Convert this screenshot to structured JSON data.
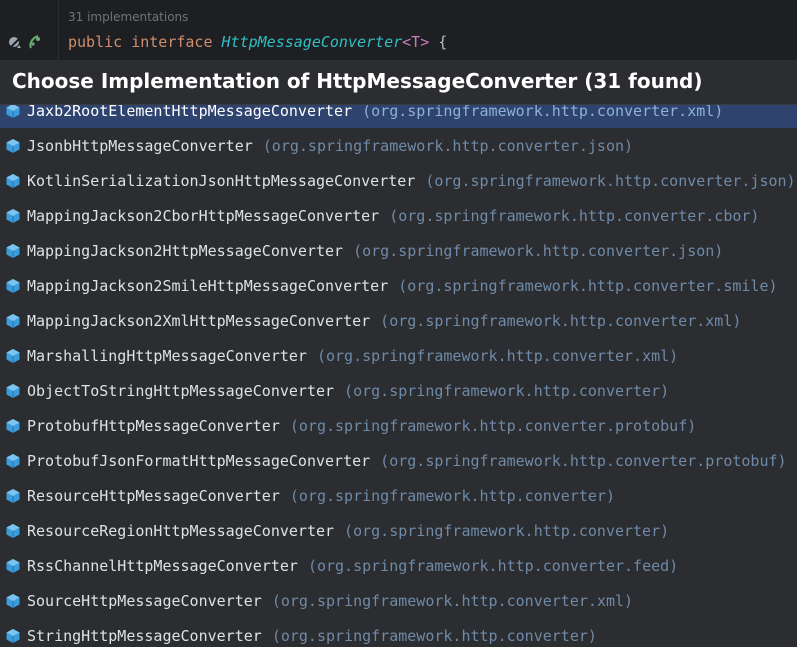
{
  "editor": {
    "hint": "31 implementations",
    "code": {
      "kw_public": "public",
      "kw_interface": "interface",
      "type_name": "HttpMessageConverter",
      "generic": "<T>",
      "brace": "{"
    },
    "gutter_icons": [
      "implementations-icon",
      "bean-icon"
    ]
  },
  "popup": {
    "title": "Choose Implementation of HttpMessageConverter (31 found)",
    "items": [
      {
        "name": "Jaxb2RootElementHttpMessageConverter",
        "package": "(org.springframework.http.converter.xml)",
        "selected": true
      },
      {
        "name": "JsonbHttpMessageConverter",
        "package": "(org.springframework.http.converter.json)"
      },
      {
        "name": "KotlinSerializationJsonHttpMessageConverter",
        "package": "(org.springframework.http.converter.json)"
      },
      {
        "name": "MappingJackson2CborHttpMessageConverter",
        "package": "(org.springframework.http.converter.cbor)"
      },
      {
        "name": "MappingJackson2HttpMessageConverter",
        "package": "(org.springframework.http.converter.json)"
      },
      {
        "name": "MappingJackson2SmileHttpMessageConverter",
        "package": "(org.springframework.http.converter.smile)"
      },
      {
        "name": "MappingJackson2XmlHttpMessageConverter",
        "package": "(org.springframework.http.converter.xml)"
      },
      {
        "name": "MarshallingHttpMessageConverter",
        "package": "(org.springframework.http.converter.xml)"
      },
      {
        "name": "ObjectToStringHttpMessageConverter",
        "package": "(org.springframework.http.converter)"
      },
      {
        "name": "ProtobufHttpMessageConverter",
        "package": "(org.springframework.http.converter.protobuf)"
      },
      {
        "name": "ProtobufJsonFormatHttpMessageConverter",
        "package": "(org.springframework.http.converter.protobuf)"
      },
      {
        "name": "ResourceHttpMessageConverter",
        "package": "(org.springframework.http.converter)"
      },
      {
        "name": "ResourceRegionHttpMessageConverter",
        "package": "(org.springframework.http.converter)"
      },
      {
        "name": "RssChannelHttpMessageConverter",
        "package": "(org.springframework.http.converter.feed)"
      },
      {
        "name": "SourceHttpMessageConverter",
        "package": "(org.springframework.http.converter.xml)"
      },
      {
        "name": "StringHttpMessageConverter",
        "package": "(org.springframework.http.converter)"
      }
    ],
    "item_icon": "interface-class-icon",
    "colors": {
      "icon": "#3c9ddd",
      "selected_bg": "#2e436e",
      "class_text": "#dfe1e5",
      "package_text": "#6f8aa8"
    }
  }
}
